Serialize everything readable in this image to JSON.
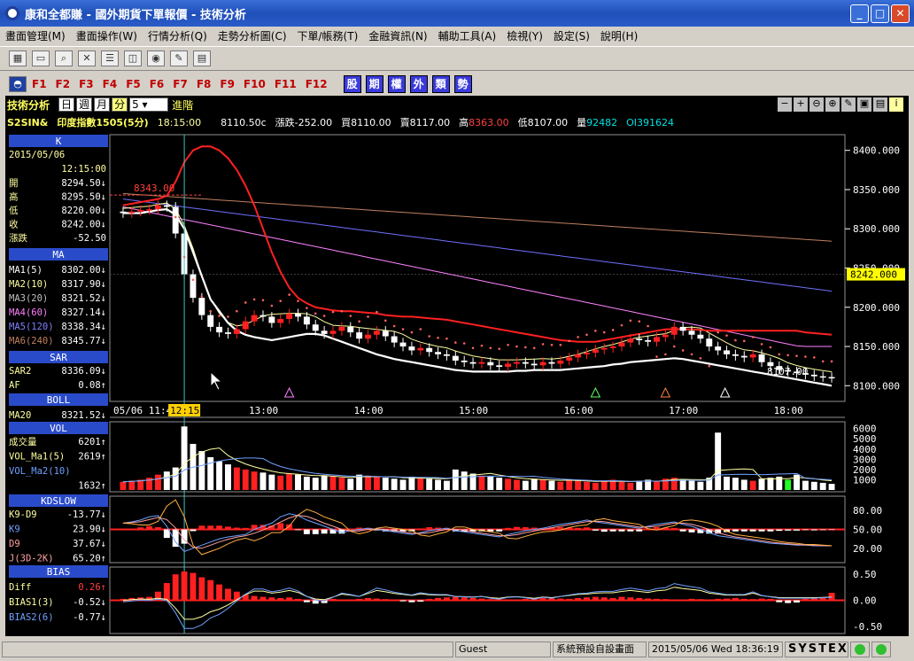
{
  "window": {
    "title": "康和全都賺 - 國外期貨下單報價 - 技術分析"
  },
  "menu": [
    "畫面管理(M)",
    "畫面操作(W)",
    "行情分析(Q)",
    "走勢分析圖(C)",
    "下單/帳務(T)",
    "金融資訊(N)",
    "輔助工具(A)",
    "檢視(Y)",
    "設定(S)",
    "說明(H)"
  ],
  "fkeys": [
    "F1",
    "F2",
    "F3",
    "F4",
    "F5",
    "F6",
    "F7",
    "F8",
    "F9",
    "F10",
    "F11",
    "F12"
  ],
  "bkeys": [
    "股",
    "期",
    "權",
    "外",
    "類",
    "勢"
  ],
  "header": {
    "label": "技術分析",
    "periods": [
      "日",
      "週",
      "月",
      "分"
    ],
    "interval": "5",
    "advanced": "進階"
  },
  "quote": {
    "symbol": "S2SIN&",
    "name": "印度指數1505(5分)",
    "time": "18:15:00",
    "last": "8110.50c",
    "change_label": "漲跌",
    "change": "-252.00",
    "bid_label": "買",
    "bid": "8110.00",
    "ask_label": "賣",
    "ask": "8117.00",
    "high_label": "高",
    "high": "8363.00",
    "low_label": "低",
    "low": "8107.00",
    "vol_label": "量",
    "vol": "92482",
    "oi": "OI391624"
  },
  "panels": {
    "k": {
      "title": "K",
      "date": "2015/05/06",
      "time": "12:15:00",
      "rows": [
        {
          "l": "開",
          "v": "8294.50↓"
        },
        {
          "l": "高",
          "v": "8295.50↓"
        },
        {
          "l": "低",
          "v": "8220.00↓"
        },
        {
          "l": "收",
          "v": "8242.00↓"
        },
        {
          "l": "漲跌",
          "v": "-52.50"
        }
      ]
    },
    "ma": {
      "title": "MA",
      "rows": [
        {
          "l": "MA1(5)",
          "v": "8302.00↓",
          "c": "#ffffff"
        },
        {
          "l": "MA2(10)",
          "v": "8317.90↓",
          "c": "#ffffa0"
        },
        {
          "l": "MA3(20)",
          "v": "8321.52↓",
          "c": "#c0c0c0"
        },
        {
          "l": "MA4(60)",
          "v": "8327.14↓",
          "c": "#ff80ff"
        },
        {
          "l": "MA5(120)",
          "v": "8338.34↓",
          "c": "#8080ff"
        },
        {
          "l": "MA6(240)",
          "v": "8345.77↓",
          "c": "#c08060"
        }
      ]
    },
    "sar": {
      "title": "SAR",
      "rows": [
        {
          "l": "SAR2",
          "v": "8336.09↓"
        },
        {
          "l": "AF",
          "v": "0.08↑"
        }
      ]
    },
    "boll": {
      "title": "BOLL",
      "rows": [
        {
          "l": "MA20",
          "v": "8321.52↓"
        }
      ]
    },
    "vol": {
      "title": "VOL",
      "rows": [
        {
          "l": "成交量",
          "v": "6201↑",
          "c": "#ffffa0"
        },
        {
          "l": "VOL_Ma1(5)",
          "v": "2619↑",
          "c": "#ffffa0"
        },
        {
          "l": "VOL_Ma2(10)",
          "v": "",
          "c": "#6fa0ff"
        },
        {
          "l": "",
          "v": "1632↑",
          "c": "#6fa0ff"
        }
      ]
    },
    "kd": {
      "title": "KDSLOW",
      "rows": [
        {
          "l": "K9-D9",
          "v": "-13.77↓",
          "c": "#ffffa0"
        },
        {
          "l": "K9",
          "v": "23.90↓",
          "c": "#6fa0ff"
        },
        {
          "l": "D9",
          "v": "37.67↓",
          "c": "#ffa0a0"
        },
        {
          "l": "J(3D-2K)",
          "v": "65.20↑",
          "c": "#ffa0a0"
        }
      ]
    },
    "bias": {
      "title": "BIAS",
      "rows": [
        {
          "l": "Diff",
          "v": "0.26↑",
          "c": "#ffffa0",
          "vc": "#ff4040"
        },
        {
          "l": "BIAS1(3)",
          "v": "-0.52↓",
          "c": "#ffffa0"
        },
        {
          "l": "BIAS2(6)",
          "v": "-0.77↓",
          "c": "#6fa0ff"
        }
      ]
    }
  },
  "axes": {
    "price_ticks": [
      "8400.000",
      "8350.000",
      "8300.000",
      "8250.000",
      "8200.000",
      "8150.000",
      "8100.000"
    ],
    "price_min": 8080,
    "price_max": 8420,
    "current_price": "8242.000",
    "time_labels": [
      {
        "t": "05/06 11:40",
        "i": 0
      },
      {
        "t": "12:15",
        "i": 7,
        "hl": true
      },
      {
        "t": "13:00",
        "i": 16
      },
      {
        "t": "14:00",
        "i": 28
      },
      {
        "t": "15:00",
        "i": 40
      },
      {
        "t": "16:00",
        "i": 52
      },
      {
        "t": "17:00",
        "i": 64
      },
      {
        "t": "18:00",
        "i": 76
      }
    ],
    "vol_ticks": [
      "6000",
      "5000",
      "4000",
      "3000",
      "2000",
      "1000"
    ],
    "kd_ticks": [
      "80.00",
      "50.00",
      "20.00"
    ],
    "bias_ticks": [
      "0.50",
      "0.00",
      "-0.50"
    ]
  },
  "annotations": {
    "hi_label": "8343.00",
    "lo_label": "8107.00"
  },
  "status": {
    "user": "Guest",
    "layout": "系統預設自設畫面",
    "datetime": "2015/05/06 Wed 18:36:19",
    "brand": "SYSTEX"
  },
  "chart_data": {
    "type": "candlestick",
    "x_count": 82,
    "close": [
      8320,
      8322,
      8324,
      8325,
      8330,
      8328,
      8294,
      8242,
      8212,
      8190,
      8175,
      8168,
      8166,
      8172,
      8182,
      8190,
      8188,
      8180,
      8185,
      8192,
      8188,
      8178,
      8170,
      8166,
      8170,
      8175,
      8168,
      8160,
      8165,
      8170,
      8163,
      8155,
      8150,
      8145,
      8148,
      8143,
      8140,
      8138,
      8132,
      8130,
      8128,
      8130,
      8126,
      8124,
      8128,
      8130,
      8128,
      8126,
      8130,
      8128,
      8132,
      8136,
      8140,
      8142,
      8146,
      8148,
      8150,
      8155,
      8160,
      8158,
      8156,
      8162,
      8165,
      8175,
      8170,
      8165,
      8160,
      8150,
      8145,
      8140,
      8138,
      8136,
      8140,
      8130,
      8125,
      8120,
      8118,
      8116,
      8114,
      8112,
      8111,
      8110
    ],
    "ma_white": [
      8320,
      8320,
      8320,
      8322,
      8324,
      8325,
      8318,
      8300,
      8270,
      8240,
      8210,
      8195,
      8180,
      8170,
      8165,
      8162,
      8160,
      8158,
      8160,
      8162,
      8164,
      8166,
      8166,
      8164,
      8160,
      8156,
      8152,
      8148,
      8144,
      8140,
      8137,
      8134,
      8132,
      8130,
      8128,
      8126,
      8124,
      8122,
      8120,
      8119,
      8118,
      8118,
      8118,
      8118,
      8118,
      8119,
      8119,
      8120,
      8120,
      8120,
      8120,
      8121,
      8122,
      8123,
      8124,
      8125,
      8127,
      8128,
      8130,
      8131,
      8132,
      8133,
      8134,
      8135,
      8134,
      8132,
      8130,
      8128,
      8126,
      8124,
      8122,
      8120,
      8118,
      8116,
      8114,
      8112,
      8110,
      8108,
      8106,
      8104,
      8102,
      8100
    ],
    "bb_upper": [
      8330,
      8332,
      8334,
      8336,
      8338,
      8342,
      8360,
      8385,
      8400,
      8405,
      8405,
      8400,
      8390,
      8375,
      8355,
      8330,
      8300,
      8270,
      8245,
      8225,
      8212,
      8205,
      8200,
      8198,
      8196,
      8195,
      8195,
      8194,
      8193,
      8192,
      8190,
      8189,
      8188,
      8188,
      8187,
      8186,
      8185,
      8184,
      8182,
      8180,
      8178,
      8176,
      8174,
      8172,
      8170,
      8168,
      8166,
      8164,
      8162,
      8160,
      8158,
      8157,
      8156,
      8156,
      8156,
      8158,
      8160,
      8162,
      8164,
      8166,
      8168,
      8170,
      8172,
      8172,
      8172,
      8172,
      8171,
      8170,
      8170,
      8170,
      8170,
      8170,
      8170,
      8170,
      8170,
      8170,
      8170,
      8170,
      8168,
      8167,
      8166,
      8165
    ],
    "vol": [
      800,
      900,
      1000,
      1200,
      1500,
      1800,
      2200,
      6201,
      4500,
      3800,
      3200,
      2800,
      2500,
      2200,
      2000,
      1800,
      1700,
      1500,
      1400,
      1600,
      1500,
      1300,
      1200,
      1400,
      1300,
      1200,
      1100,
      1500,
      1400,
      1300,
      1200,
      1100,
      1000,
      1300,
      1200,
      1100,
      1000,
      900,
      2000,
      1800,
      1600,
      1400,
      1300,
      1200,
      1100,
      1000,
      900,
      1100,
      1000,
      900,
      800,
      1000,
      900,
      800,
      700,
      900,
      1000,
      800,
      700,
      900,
      1000,
      900,
      1100,
      1200,
      1000,
      900,
      800,
      1200,
      5600,
      1300,
      1200,
      1000,
      900,
      1100,
      1200,
      1300,
      1000,
      1500,
      900,
      800,
      700,
      600
    ],
    "kd_k": [
      60,
      62,
      65,
      70,
      72,
      55,
      30,
      15,
      20,
      25,
      30,
      35,
      38,
      40,
      42,
      50,
      55,
      60,
      70,
      75,
      72,
      65,
      60,
      55,
      50,
      45,
      48,
      50,
      52,
      50,
      48,
      46,
      44,
      42,
      45,
      48,
      50,
      52,
      48,
      46,
      44,
      42,
      40,
      38,
      42,
      45,
      48,
      50,
      52,
      55,
      58,
      60,
      62,
      65,
      62,
      60,
      58,
      56,
      54,
      52,
      55,
      58,
      60,
      62,
      58,
      55,
      50,
      45,
      40,
      38,
      36,
      34,
      32,
      30,
      28,
      27,
      26,
      25,
      25,
      24,
      24,
      23.9
    ],
    "diff": [
      0.05,
      0.08,
      0.1,
      0.12,
      0.3,
      0.6,
      0.9,
      1.0,
      0.95,
      0.8,
      0.7,
      0.55,
      0.4,
      0.3,
      0.2,
      0.15,
      0.12,
      0.1,
      0.08,
      0.1,
      0.05,
      -0.05,
      -0.1,
      -0.08,
      0.05,
      0.02,
      0.03,
      0.05,
      0.08,
      0.06,
      0.04,
      0.02,
      -0.02,
      -0.05,
      -0.03,
      0.05,
      0.08,
      0.1,
      0.12,
      0.1,
      0.08,
      0.06,
      0.04,
      0.03,
      0.02,
      0.03,
      0.05,
      0.06,
      0.08,
      0.07,
      0.06,
      0.05,
      0.08,
      0.1,
      0.12,
      0.1,
      0.08,
      0.12,
      0.1,
      0.08,
      0.06,
      0.05,
      0.04,
      0.03,
      0.02,
      0.05,
      0.04,
      0.03,
      0.05,
      0.06,
      0.08,
      0.05,
      0.04,
      0.06,
      0.05,
      -0.05,
      -0.08,
      -0.06,
      0.05,
      0.08,
      0.1,
      0.26
    ]
  }
}
